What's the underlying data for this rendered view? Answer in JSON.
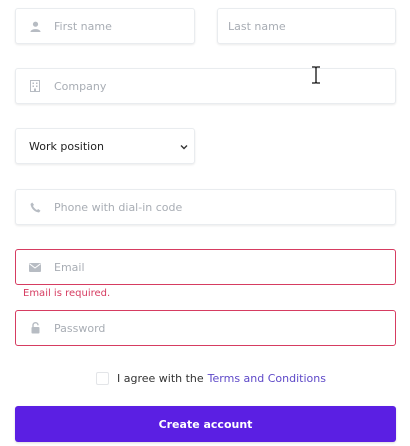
{
  "form": {
    "first_name": {
      "placeholder": "First name",
      "icon": "user-icon"
    },
    "last_name": {
      "placeholder": "Last name"
    },
    "company": {
      "placeholder": "Company",
      "icon": "building-icon"
    },
    "work_position": {
      "selected": "Work position"
    },
    "phone": {
      "placeholder": "Phone with dial-in code",
      "icon": "phone-icon"
    },
    "email": {
      "placeholder": "Email",
      "icon": "envelope-icon",
      "error": "Email is required."
    },
    "password": {
      "placeholder": "Password",
      "icon": "lock-icon"
    },
    "agree": {
      "label": "I agree with the",
      "link": "Terms and Conditions"
    },
    "submit_label": "Create account"
  },
  "colors": {
    "accent": "#5b1fe3",
    "error": "#d63c61",
    "link": "#5e49c8"
  }
}
